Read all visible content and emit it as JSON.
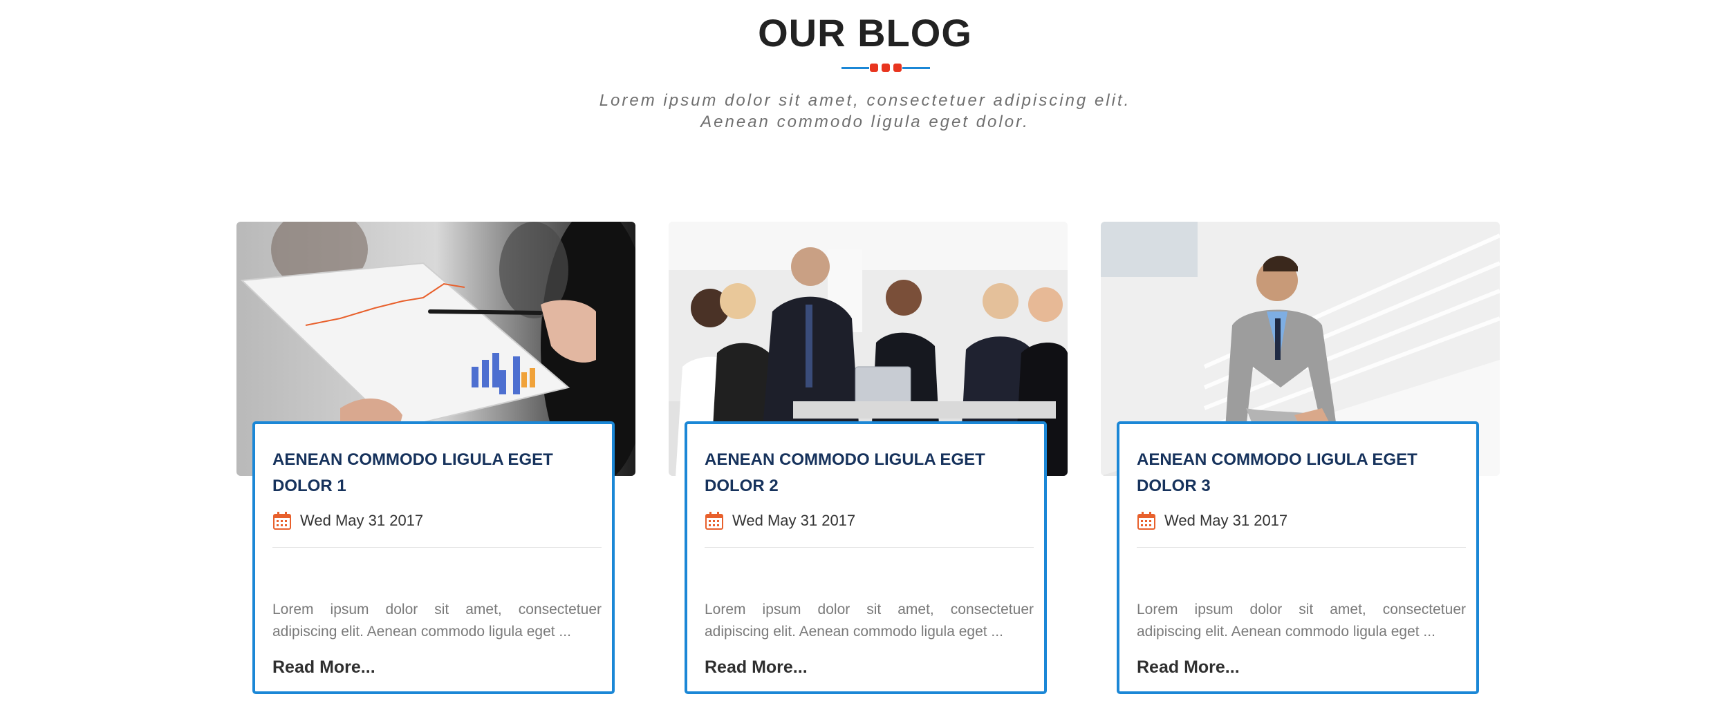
{
  "section": {
    "title": "OUR BLOG",
    "subtitle_line1": "Lorem ipsum dolor sit amet, consectetuer adipiscing elit.",
    "subtitle_line2": "Aenean commodo ligula eget dolor."
  },
  "colors": {
    "accent_blue": "#1b87d6",
    "accent_red": "#e8351f",
    "title_navy": "#16325c",
    "calendar_orange": "#e8602c"
  },
  "posts": [
    {
      "title": "AENEAN COMMODO LIGULA EGET DOLOR 1",
      "date": "Wed May 31 2017",
      "excerpt": "Lorem ipsum dolor sit amet, consectetuer adipiscing elit. Aenean commodo ligula eget ...",
      "read_more": "Read More...",
      "image_icon": "business-chart-meeting-photo"
    },
    {
      "title": "AENEAN COMMODO LIGULA EGET DOLOR 2",
      "date": "Wed May 31 2017",
      "excerpt": "Lorem ipsum dolor sit amet, consectetuer adipiscing elit. Aenean commodo ligula eget ...",
      "read_more": "Read More...",
      "image_icon": "business-team-photo"
    },
    {
      "title": "AENEAN COMMODO LIGULA EGET DOLOR 3",
      "date": "Wed May 31 2017",
      "excerpt": "Lorem ipsum dolor sit amet, consectetuer adipiscing elit. Aenean commodo ligula eget ...",
      "read_more": "Read More...",
      "image_icon": "businessman-railing-photo"
    }
  ]
}
